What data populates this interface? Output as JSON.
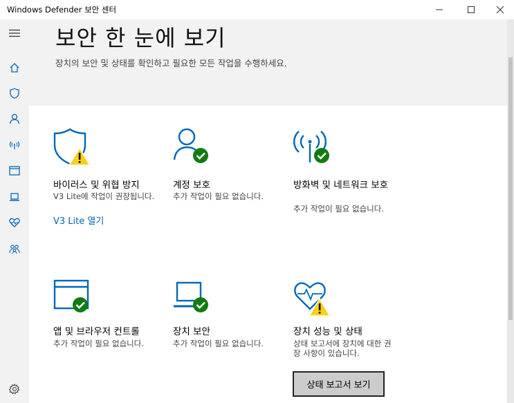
{
  "window": {
    "title": "Windows Defender 보안 센터",
    "controls": {
      "minimize": "minimize-icon",
      "maximize": "maximize-icon",
      "close": "close-icon"
    }
  },
  "sidebar": {
    "items": [
      {
        "name": "menu",
        "icon": "hamburger-icon"
      },
      {
        "name": "home",
        "icon": "home-icon"
      },
      {
        "name": "virus-protection",
        "icon": "shield-icon"
      },
      {
        "name": "account-protection",
        "icon": "person-icon"
      },
      {
        "name": "firewall",
        "icon": "antenna-icon"
      },
      {
        "name": "app-browser-control",
        "icon": "browser-window-icon"
      },
      {
        "name": "device-security",
        "icon": "laptop-icon"
      },
      {
        "name": "device-performance",
        "icon": "heart-icon"
      },
      {
        "name": "family-options",
        "icon": "family-icon"
      },
      {
        "name": "settings",
        "icon": "gear-icon"
      }
    ]
  },
  "header": {
    "title": "보안 한 눈에 보기",
    "subtitle": "장치의 보안 및 상태를 확인하고 필요한 모든 작업을 수행하세요."
  },
  "tiles": [
    {
      "title": "바이러스 및 위협 방지",
      "desc": "V3 Lite에 작업이 권장됩니다.",
      "link": "V3 Lite 열기",
      "status": "warning",
      "icon": "shield-warning-icon"
    },
    {
      "title": "계정 보호",
      "desc": "추가 작업이 필요 없습니다.",
      "status": "ok",
      "icon": "person-check-icon"
    },
    {
      "title": "방화벽 및 네트워크 보호",
      "desc": "추가 작업이 필요 없습니다.",
      "status": "ok",
      "icon": "antenna-check-icon"
    },
    {
      "title": "앱 및 브라우저 컨트롤",
      "desc": "추가 작업이 필요 없습니다.",
      "status": "ok",
      "icon": "browser-check-icon"
    },
    {
      "title": "장치 보안",
      "desc": "추가 작업이 필요 없습니다.",
      "status": "ok",
      "icon": "laptop-check-icon"
    },
    {
      "title": "장치 성능 및 상태",
      "desc": "상태 보고서에 장치에 대한 권장 사항이 있습니다.",
      "button": "상태 보고서 보기",
      "status": "warning",
      "icon": "heart-warning-icon"
    }
  ],
  "colors": {
    "accent": "#0067b8",
    "ok": "#107c10",
    "warning": "#fcd116",
    "header_bg": "#f2f2f2"
  }
}
